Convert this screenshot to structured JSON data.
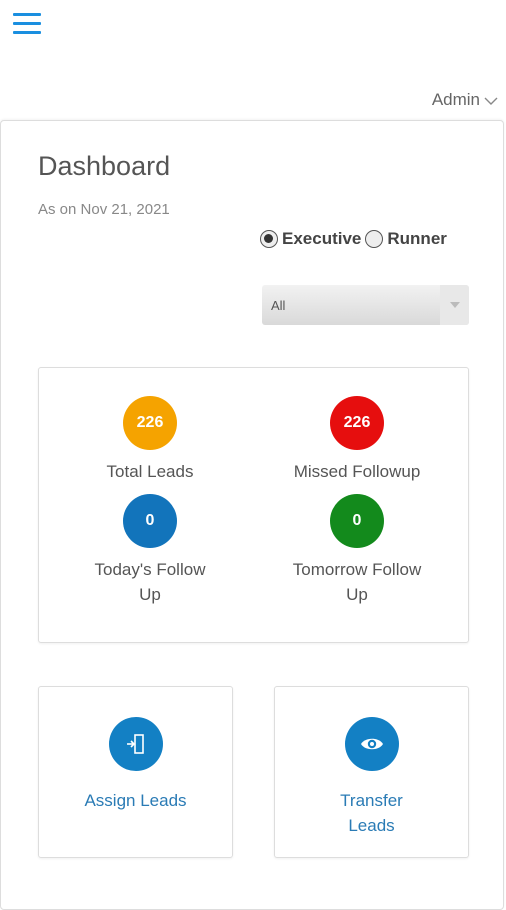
{
  "header": {
    "menu_icon": "hamburger-menu-icon",
    "user_label": "Admin",
    "user_chevron_icon": "chevron-down-icon"
  },
  "dashboard": {
    "title": "Dashboard",
    "as_of": "As on Nov 21, 2021",
    "role_options": [
      {
        "label": "Executive",
        "checked": true
      },
      {
        "label": "Runner",
        "checked": false
      }
    ],
    "filter": {
      "selected": "All"
    }
  },
  "stats": [
    {
      "value": "226",
      "label_line1": "Total Leads",
      "label_line2": "",
      "color": "#f5a300"
    },
    {
      "value": "226",
      "label_line1": "Missed Followup",
      "label_line2": "",
      "color": "#e60e0e"
    },
    {
      "value": "0",
      "label_line1": "Today's Follow",
      "label_line2": "Up",
      "color": "#1274bb"
    },
    {
      "value": "0",
      "label_line1": "Tomorrow Follow",
      "label_line2": "Up",
      "color": "#138a1c"
    }
  ],
  "actions": [
    {
      "label_line1": "Assign Leads",
      "label_line2": "",
      "icon": "assign-door-icon"
    },
    {
      "label_line1": "Transfer",
      "label_line2": "Leads",
      "icon": "eye-icon"
    }
  ],
  "colors": {
    "accent_blue": "#1a8fe0",
    "action_blue": "#1380c4",
    "link_text": "#2a7bb5"
  }
}
